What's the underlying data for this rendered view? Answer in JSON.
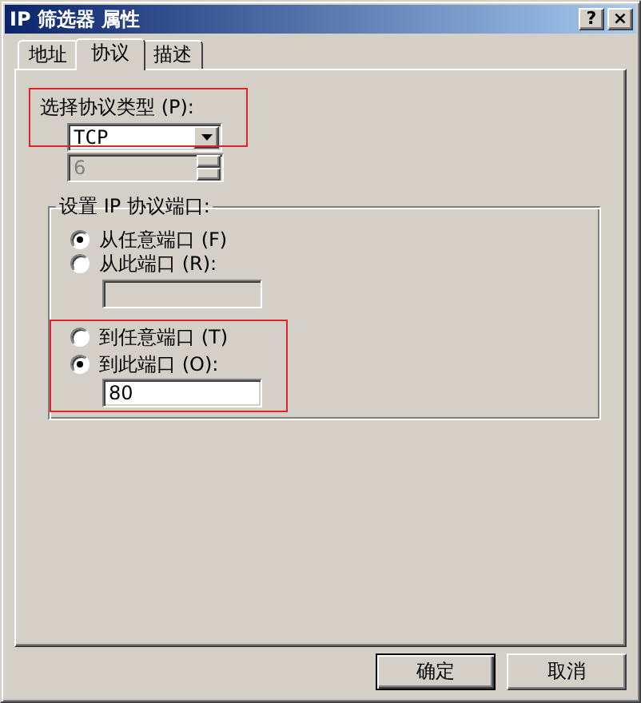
{
  "window": {
    "title": "IP 筛选器 属性",
    "title_buttons": [
      "?",
      "×"
    ]
  },
  "tabs": [
    {
      "label": "地址",
      "selected": false
    },
    {
      "label": "协议",
      "selected": true
    },
    {
      "label": "描述",
      "selected": false
    }
  ],
  "protocol": {
    "highlighted": true,
    "label": "选择协议类型 (P):",
    "value": "TCP",
    "number": {
      "value": "6",
      "disabled": true
    }
  },
  "port_group": {
    "title": "设置 IP 协议端口:",
    "from_port": {
      "options": [
        {
          "label": "从任意端口 (F)",
          "selected": true
        },
        {
          "label": "从此端口 (R):",
          "selected": false
        }
      ],
      "field": {
        "disabled": true
      }
    },
    "to_port": {
      "highlighted": true,
      "options": [
        {
          "label": "到任意端口 (T)",
          "selected": false
        },
        {
          "label": "到此端口 (O):",
          "selected": true
        }
      ],
      "field": {
        "value": "80",
        "disabled": false
      }
    }
  },
  "buttons": [
    {
      "label": "确定",
      "default": true
    },
    {
      "label": "取消",
      "default": false
    }
  ]
}
